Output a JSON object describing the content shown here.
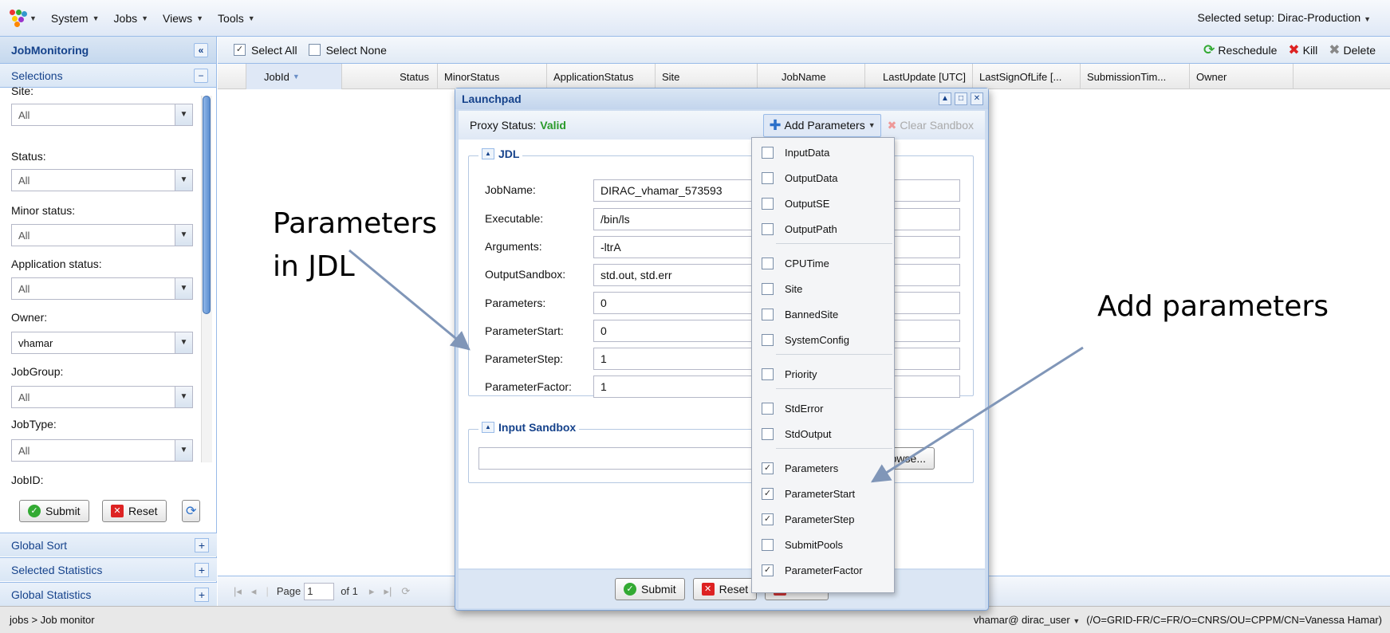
{
  "menubar": {
    "items": [
      {
        "label": "System"
      },
      {
        "label": "Jobs"
      },
      {
        "label": "Views"
      },
      {
        "label": "Tools"
      }
    ],
    "setup": "Selected setup:  Dirac-Production"
  },
  "left": {
    "title": "JobMonitoring",
    "selections": "Selections",
    "filters": [
      {
        "label": "Site:",
        "value": "All"
      },
      {
        "label": "Status:",
        "value": "All"
      },
      {
        "label": "Minor status:",
        "value": "All"
      },
      {
        "label": "Application status:",
        "value": "All"
      },
      {
        "label": "Owner:",
        "value": "vhamar"
      },
      {
        "label": "JobGroup:",
        "value": "All"
      },
      {
        "label": "JobType:",
        "value": "All"
      }
    ],
    "jobid_label": "JobID:",
    "submit": "Submit",
    "reset": "Reset",
    "accordions": [
      "Global Sort",
      "Selected Statistics",
      "Global Statistics"
    ]
  },
  "grid": {
    "select_all": "Select All",
    "select_none": "Select None",
    "reschedule": "Reschedule",
    "kill": "Kill",
    "delete": "Delete",
    "columns": [
      "JobId",
      "Status",
      "MinorStatus",
      "ApplicationStatus",
      "Site",
      "JobName",
      "LastUpdate [UTC]",
      "LastSignOfLife [...",
      "SubmissionTim...",
      "Owner"
    ]
  },
  "pager": {
    "page_label": "Page",
    "page_value": "1",
    "of": "of 1"
  },
  "status": {
    "breadcrumb": "jobs > Job monitor",
    "user": "vhamar@  dirac_user",
    "dn": "(/O=GRID-FR/C=FR/O=CNRS/OU=CPPM/CN=Vanessa Hamar)"
  },
  "launchpad": {
    "title": "Launchpad",
    "proxy_label": "Proxy Status:",
    "proxy_value": "Valid",
    "add_params": "Add Parameters",
    "clear_sandbox": "Clear Sandbox",
    "jdl_legend": "JDL",
    "fields": [
      {
        "label": "JobName:",
        "value": "DIRAC_vhamar_573593"
      },
      {
        "label": "Executable:",
        "value": "/bin/ls"
      },
      {
        "label": "Arguments:",
        "value": "-ltrA"
      },
      {
        "label": "OutputSandbox:",
        "value": "std.out, std.err"
      },
      {
        "label": "Parameters:",
        "value": "0"
      },
      {
        "label": "ParameterStart:",
        "value": "0"
      },
      {
        "label": "ParameterStep:",
        "value": "1"
      },
      {
        "label": "ParameterFactor:",
        "value": "1"
      }
    ],
    "sandbox_legend": "Input Sandbox",
    "browse": "Browse...",
    "submit": "Submit",
    "reset": "Reset",
    "close": "Close"
  },
  "dropdown": [
    {
      "label": "InputData",
      "checked": false
    },
    {
      "label": "OutputData",
      "checked": false
    },
    {
      "label": "OutputSE",
      "checked": false
    },
    {
      "label": "OutputPath",
      "checked": false
    },
    {
      "label": "CPUTime",
      "checked": false
    },
    {
      "label": "Site",
      "checked": false
    },
    {
      "label": "BannedSite",
      "checked": false
    },
    {
      "label": "SystemConfig",
      "checked": false
    },
    {
      "label": "Priority",
      "checked": false
    },
    {
      "label": "StdError",
      "checked": false
    },
    {
      "label": "StdOutput",
      "checked": false
    },
    {
      "label": "Parameters",
      "checked": true
    },
    {
      "label": "ParameterStart",
      "checked": true
    },
    {
      "label": "ParameterStep",
      "checked": true
    },
    {
      "label": "SubmitPools",
      "checked": false
    },
    {
      "label": "ParameterFactor",
      "checked": true
    }
  ],
  "annotations": {
    "left_line1": "Parameters",
    "left_line2": "in JDL",
    "right": "Add parameters"
  },
  "colors": {
    "accent": "#15428b",
    "valid": "#2a9a2a",
    "arrow": "#8096b8"
  }
}
